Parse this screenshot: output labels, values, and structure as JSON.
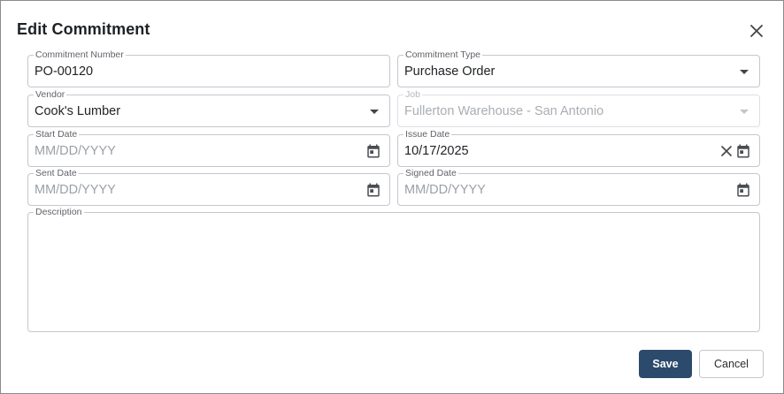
{
  "dialog": {
    "title": "Edit Commitment"
  },
  "fields": {
    "commitment_number": {
      "label": "Commitment Number",
      "value": "PO-00120"
    },
    "commitment_type": {
      "label": "Commitment Type",
      "value": "Purchase Order"
    },
    "vendor": {
      "label": "Vendor",
      "value": "Cook's Lumber"
    },
    "job": {
      "label": "Job",
      "value": "Fullerton Warehouse - San Antonio",
      "disabled": true
    },
    "start_date": {
      "label": "Start Date",
      "placeholder": "MM/DD/YYYY"
    },
    "issue_date": {
      "label": "Issue Date",
      "value": "10/17/2025"
    },
    "sent_date": {
      "label": "Sent Date",
      "placeholder": "MM/DD/YYYY"
    },
    "signed_date": {
      "label": "Signed Date",
      "placeholder": "MM/DD/YYYY"
    },
    "description": {
      "label": "Description",
      "value": ""
    }
  },
  "actions": {
    "save_label": "Save",
    "cancel_label": "Cancel"
  },
  "colors": {
    "primary": "#2c4a6b",
    "border": "#c4c7cc",
    "placeholder": "#9ba0a6"
  },
  "icons": {
    "close": "close-icon",
    "calendar": "calendar-icon",
    "clear": "clear-icon",
    "dropdown": "chevron-down-icon"
  }
}
